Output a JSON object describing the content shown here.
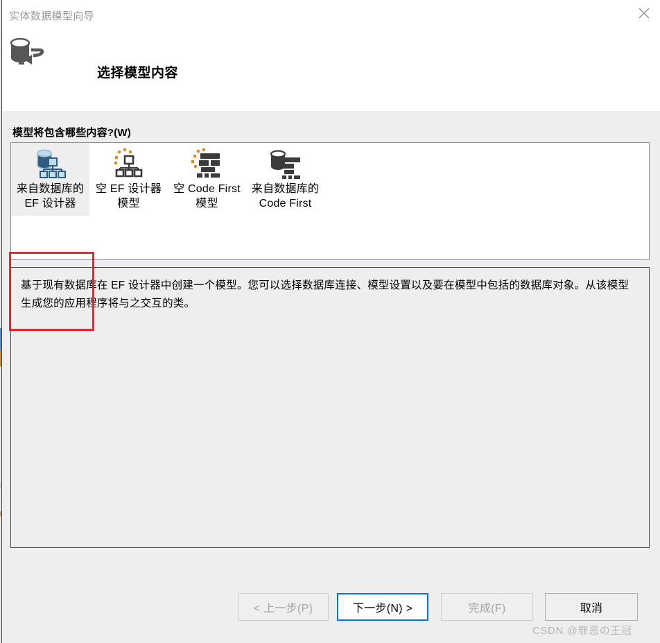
{
  "window": {
    "title": "实体数据模型向导",
    "close_icon": "close-icon",
    "header_icon": "database-plug-icon",
    "page_heading": "选择模型内容"
  },
  "main": {
    "prompt_label": "模型将包含哪些内容?(W)",
    "model_options": [
      {
        "label": "来自数据库的\nEF 设计器",
        "icon": "database-diagram-icon",
        "selected": true,
        "highlighted": true
      },
      {
        "label": "空 EF 设计器\n模型",
        "icon": "empty-diagram-icon",
        "selected": false,
        "highlighted": false
      },
      {
        "label": "空 Code First\n模型",
        "icon": "empty-code-first-icon",
        "selected": false,
        "highlighted": false
      },
      {
        "label": "来自数据库的\nCode First",
        "icon": "database-code-first-icon",
        "selected": false,
        "highlighted": false
      }
    ],
    "description": "基于现有数据库在 EF 设计器中创建一个模型。您可以选择数据库连接、模型设置以及要在模型中包括的数据库对象。从该模型生成您的应用程序将与之交互的类。"
  },
  "buttons": {
    "back": "< 上一步(P)",
    "next": "下一步(N) >",
    "finish": "完成(F)",
    "cancel": "取消"
  },
  "watermark": "CSDN @罪恶の王冠",
  "colors": {
    "accent": "#0078d7",
    "highlight": "#f5222d",
    "icon_blue": "#2f5d80",
    "icon_dark": "#3b3b3b",
    "icon_orange": "#e08a1e",
    "window_bg": "#eeeeee",
    "header_bg": "#ffffff"
  }
}
